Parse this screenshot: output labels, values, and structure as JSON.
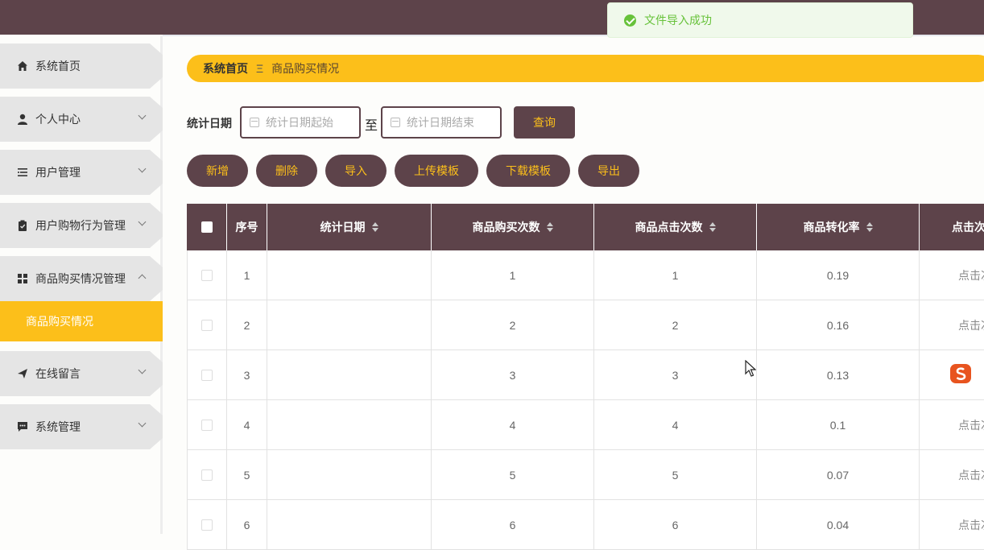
{
  "toast": {
    "message": "文件导入成功"
  },
  "sidebar": {
    "items": [
      {
        "label": "系统首页",
        "icon": "home-icon"
      },
      {
        "label": "个人中心",
        "icon": "user-icon"
      },
      {
        "label": "用户管理",
        "icon": "list-icon"
      },
      {
        "label": "用户购物行为管理",
        "icon": "clipboard-icon"
      },
      {
        "label": "商品购买情况管理",
        "icon": "grid-icon"
      },
      {
        "label": "在线留言",
        "icon": "send-icon"
      },
      {
        "label": "系统管理",
        "icon": "message-icon"
      }
    ],
    "active_sub": "商品购买情况"
  },
  "breadcrumb": {
    "home": "系统首页",
    "separator": "Ξ",
    "current": "商品购买情况"
  },
  "search": {
    "label": "统计日期",
    "start_placeholder": "统计日期起始",
    "to": "至",
    "end_placeholder": "统计日期结束",
    "query": "查询"
  },
  "actions": {
    "add": "新增",
    "delete": "删除",
    "import": "导入",
    "upload_template": "上传模板",
    "download_template": "下载模板",
    "export": "导出"
  },
  "table": {
    "headers": {
      "index": "序号",
      "date": "统计日期",
      "buy": "商品购买次数",
      "click": "商品点击次数",
      "rate": "商品转化率",
      "action": "点击次"
    },
    "rows": [
      {
        "index": "1",
        "date": "",
        "buy": "1",
        "click": "1",
        "rate": "0.19",
        "action": "点击次"
      },
      {
        "index": "2",
        "date": "",
        "buy": "2",
        "click": "2",
        "rate": "0.16",
        "action": "点击次"
      },
      {
        "index": "3",
        "date": "",
        "buy": "3",
        "click": "3",
        "rate": "0.13",
        "action": ""
      },
      {
        "index": "4",
        "date": "",
        "buy": "4",
        "click": "4",
        "rate": "0.1",
        "action": "点击次"
      },
      {
        "index": "5",
        "date": "",
        "buy": "5",
        "click": "5",
        "rate": "0.07",
        "action": "点击次"
      },
      {
        "index": "6",
        "date": "",
        "buy": "6",
        "click": "6",
        "rate": "0.04",
        "action": "点击次"
      }
    ]
  },
  "colors": {
    "header": "#5d434a",
    "accent": "#fcbf1a",
    "success": "#67c23a"
  }
}
